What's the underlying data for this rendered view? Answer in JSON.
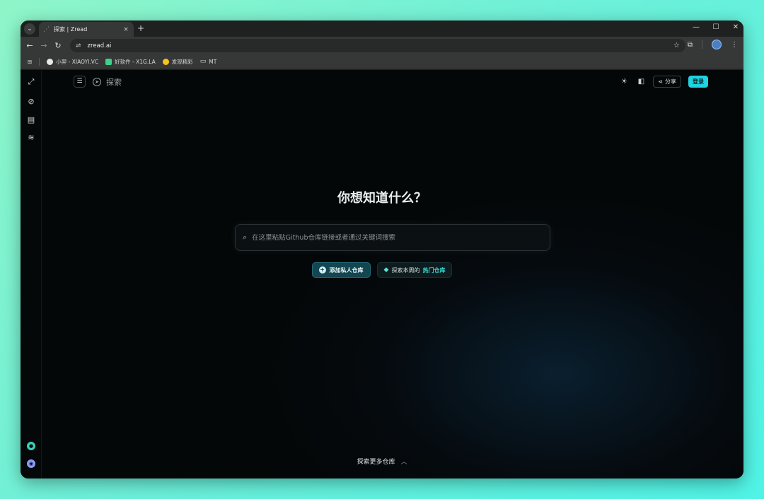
{
  "browser": {
    "tab": {
      "title": "探索 | Zread",
      "close": "×"
    },
    "new_tab": "+",
    "window_controls": {
      "minimize": "—",
      "maximize": "☐",
      "close": "✕"
    },
    "nav": {
      "back": "←",
      "forward": "→",
      "reload": "↻"
    },
    "omnibox": {
      "url": "zread.ai",
      "site_info": "⇌",
      "star": "☆"
    },
    "toolbar_icons": {
      "extensions": "⧉",
      "menu": "⋮"
    },
    "bookmarks": [
      {
        "label": "小羿 - XIAOYI.VC",
        "color": "#e8e8e8"
      },
      {
        "label": "好软件 - X1G.LA",
        "color": "#3fcf8e"
      },
      {
        "label": "发现精彩",
        "color": "#f5c518"
      },
      {
        "label": "MT",
        "color": ""
      }
    ],
    "apps_icon": "⊞"
  },
  "page": {
    "header": {
      "title": "探索",
      "share_label": "分享",
      "login_label": "登录"
    },
    "hero": {
      "title": "你想知道什么？"
    },
    "search": {
      "placeholder": "在这里粘贴Github仓库链接或者通过关键词搜索"
    },
    "cta": {
      "primary_label": "添加私人仓库",
      "secondary_prefix": "探索本周的",
      "secondary_link": "热门仓库"
    },
    "footer": {
      "explore_more": "探索更多仓库"
    }
  },
  "colors": {
    "accent": "#1fd3e0",
    "primary_button_bg": "#134650",
    "hot_link": "#35d9d1",
    "page_bg": "#050a0e"
  }
}
